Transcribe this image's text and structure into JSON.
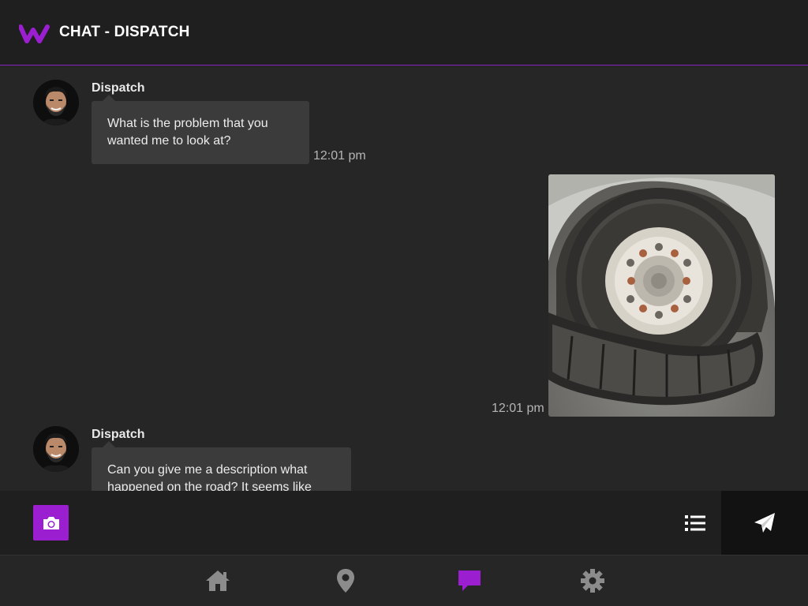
{
  "header": {
    "title": "CHAT - DISPATCH",
    "logo_icon": "brand-w-logo",
    "accent_color": "#9b1fd1"
  },
  "messages": [
    {
      "sender": "Dispatch",
      "text": "What is the problem that you wanted me to look at?",
      "time": "12:01 pm",
      "direction": "incoming"
    },
    {
      "type": "image",
      "image_description": "flat-tire-photo",
      "time": "12:01 pm",
      "direction": "outgoing"
    },
    {
      "sender": "Dispatch",
      "text": "Can you give me a description what happened on the road? It seems like",
      "direction": "incoming"
    }
  ],
  "composer": {
    "camera_icon": "camera-icon",
    "list_icon": "list-icon",
    "send_icon": "send-icon"
  },
  "nav": {
    "items": [
      "home-icon",
      "location-pin-icon",
      "chat-icon",
      "gear-icon"
    ],
    "active": "chat-icon",
    "inactive_color": "#8c8c8c",
    "active_color": "#9b1fd1"
  }
}
